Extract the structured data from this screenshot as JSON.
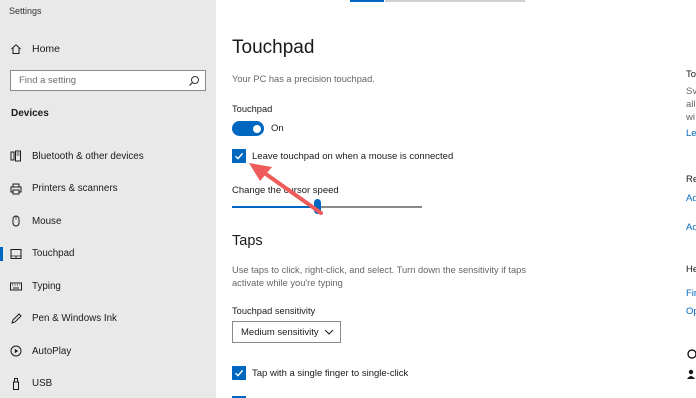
{
  "window": {
    "title": "Settings"
  },
  "sidebar": {
    "home_label": "Home",
    "search_placeholder": "Find a setting",
    "section_title": "Devices",
    "items": [
      {
        "label": "Bluetooth & other devices",
        "icon": "bluetooth-devices-icon",
        "active": false
      },
      {
        "label": "Printers & scanners",
        "icon": "printer-icon",
        "active": false
      },
      {
        "label": "Mouse",
        "icon": "mouse-icon",
        "active": false
      },
      {
        "label": "Touchpad",
        "icon": "touchpad-icon",
        "active": true
      },
      {
        "label": "Typing",
        "icon": "keyboard-icon",
        "active": false
      },
      {
        "label": "Pen & Windows Ink",
        "icon": "pen-icon",
        "active": false
      },
      {
        "label": "AutoPlay",
        "icon": "autoplay-icon",
        "active": false
      },
      {
        "label": "USB",
        "icon": "usb-icon",
        "active": false
      }
    ]
  },
  "main": {
    "title": "Touchpad",
    "precision_note": "Your PC has a precision touchpad.",
    "touchpad_label": "Touchpad",
    "toggle_state": "On",
    "toggle_on": true,
    "leave_on_checkbox": {
      "label": "Leave touchpad on when a mouse is connected",
      "checked": true
    },
    "cursor_speed_label": "Change the cursor speed",
    "cursor_speed_fraction": 0.45,
    "taps": {
      "heading": "Taps",
      "description": "Use taps to click, right-click, and select. Turn down the sensitivity if taps activate while you're typing",
      "sensitivity_label": "Touchpad sensitivity",
      "sensitivity_value": "Medium sensitivity",
      "single_tap_checkbox": {
        "label": "Tap with a single finger to single-click",
        "checked": true
      }
    }
  },
  "right_column": {
    "texts": [
      "To",
      "Sv",
      "all",
      "wi",
      "Le",
      "Re",
      "Ad",
      "Ad",
      "He",
      "Fir",
      "Op"
    ]
  },
  "colors": {
    "accent": "#0067c0",
    "sidebar_bg": "#e9e9e9",
    "annotation_arrow": "#ef5b5b"
  }
}
